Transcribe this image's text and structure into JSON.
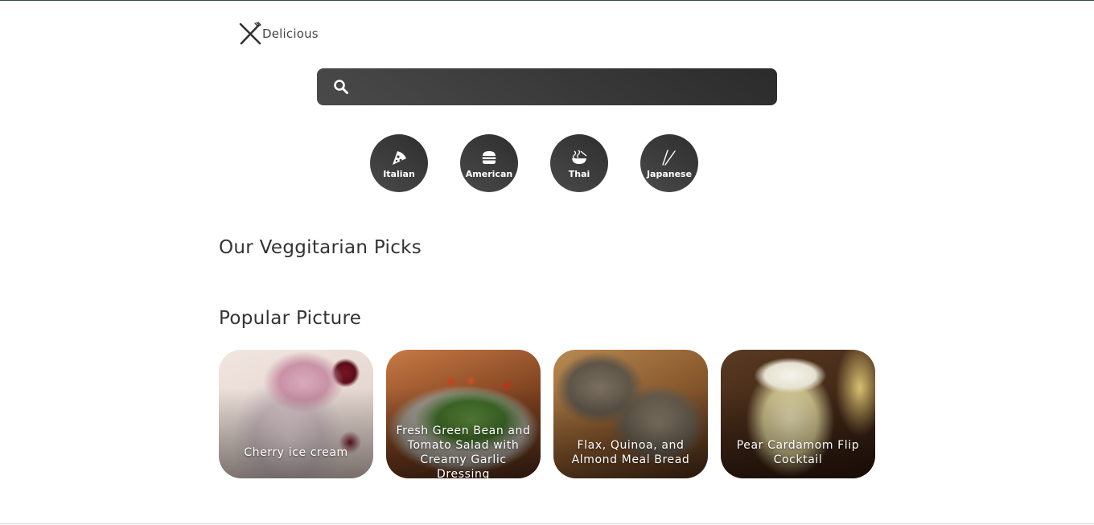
{
  "brand": {
    "name": "Delicious",
    "icon": "fork-knife-icon"
  },
  "search": {
    "placeholder": "",
    "value": "",
    "icon": "search-icon"
  },
  "cuisines": [
    {
      "label": "Italian",
      "icon": "pizza-icon"
    },
    {
      "label": "American",
      "icon": "burger-icon"
    },
    {
      "label": "Thai",
      "icon": "noodle-bowl-icon"
    },
    {
      "label": "Japanese",
      "icon": "chopsticks-icon"
    }
  ],
  "sections": {
    "veggie_title": "Our Veggitarian Picks",
    "popular_title": "Popular Picture"
  },
  "popular": [
    {
      "title": "Cherry ice cream"
    },
    {
      "title": "Fresh Green Bean and Tomato Salad with Creamy Garlic Dressing"
    },
    {
      "title": "Flax, Quinoa, and Almond Meal Bread"
    },
    {
      "title": "Pear Cardamom Flip Cocktail"
    }
  ],
  "colors": {
    "accent": "#3a3a3a",
    "text": "#333333",
    "white": "#ffffff"
  }
}
